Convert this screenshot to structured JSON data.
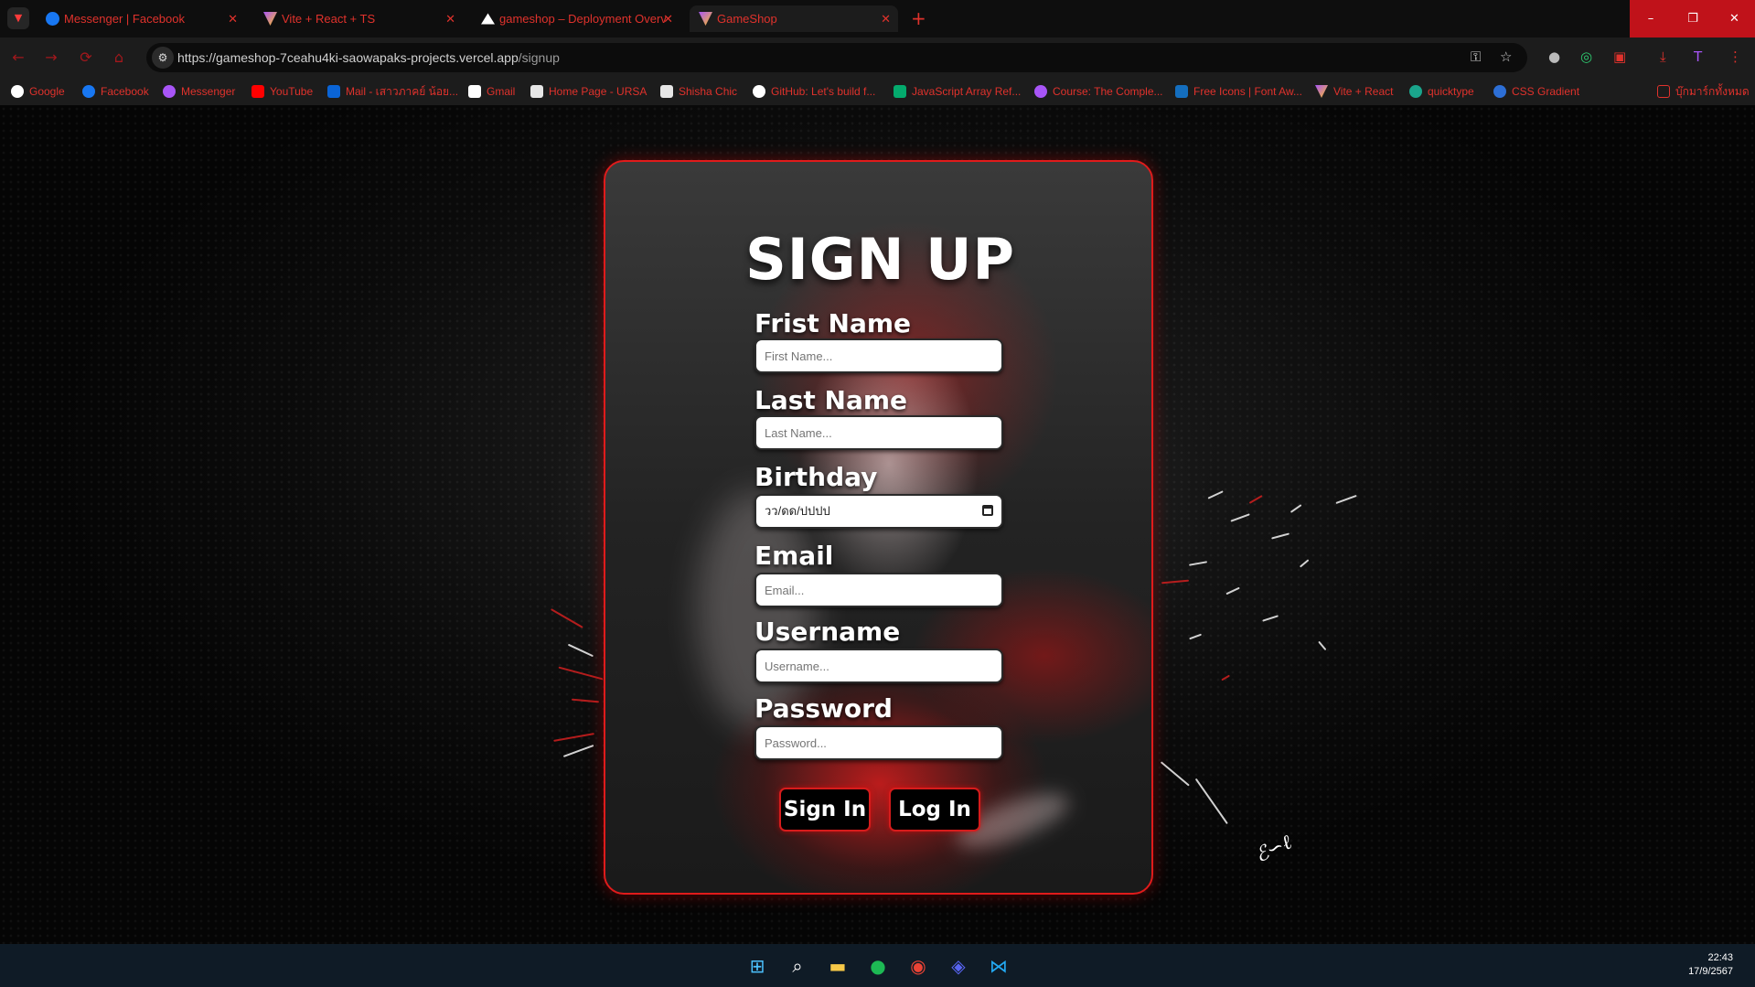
{
  "tabs": [
    {
      "title": "Messenger | Facebook",
      "icon": "facebook-icon",
      "color": "#1877f2"
    },
    {
      "title": "Vite + React + TS",
      "icon": "vite-icon",
      "color": "#a855f7"
    },
    {
      "title": "gameshop – Deployment Overv",
      "icon": "vercel-icon",
      "color": "#ffffff"
    },
    {
      "title": "GameShop",
      "icon": "vite-icon",
      "color": "#a855f7"
    }
  ],
  "window": {
    "minimize": "–",
    "restore": "❐",
    "close": "✕"
  },
  "address": {
    "origin": "https://gameshop-7ceahu4ki-saowapaks-projects.vercel.app",
    "path": "/signup"
  },
  "bookmarks": [
    {
      "label": "Google",
      "icon": "google-icon",
      "color": "#ffffff"
    },
    {
      "label": "Facebook",
      "icon": "facebook-icon",
      "color": "#1877f2"
    },
    {
      "label": "Messenger",
      "icon": "messenger-icon",
      "color": "#a855f7"
    },
    {
      "label": "YouTube",
      "icon": "youtube-icon",
      "color": "#ff0000"
    },
    {
      "label": "Mail - เสาวภาคย์ น้อย...",
      "icon": "outlook-icon",
      "color": "#0a64d6"
    },
    {
      "label": "Gmail",
      "icon": "gmail-icon",
      "color": "#ffffff"
    },
    {
      "label": "Home Page - URSA",
      "icon": "page-icon",
      "color": "#e6e6e6"
    },
    {
      "label": "Shisha Chic",
      "icon": "shisha-icon",
      "color": "#e6e6e6"
    },
    {
      "label": "GitHub: Let's build f...",
      "icon": "github-icon",
      "color": "#ffffff"
    },
    {
      "label": "JavaScript Array Ref...",
      "icon": "w3-icon",
      "color": "#04aa6d"
    },
    {
      "label": "Course: The Comple...",
      "icon": "course-icon",
      "color": "#a855f7"
    },
    {
      "label": "Free Icons | Font Aw...",
      "icon": "flag-icon",
      "color": "#146ebe"
    },
    {
      "label": "Vite + React",
      "icon": "vite-icon",
      "color": "#a855f7"
    },
    {
      "label": "quicktype",
      "icon": "quicktype-icon",
      "color": "#1aa58c"
    },
    {
      "label": "CSS Gradient",
      "icon": "gradient-icon",
      "color": "#2d6fd6"
    },
    {
      "label": "บุ๊กมาร์กทั้งหมด",
      "icon": "folder-icon",
      "color": "#e0322c"
    }
  ],
  "form": {
    "title": "SIGN UP",
    "first_name": {
      "label": "Frist Name",
      "placeholder": "First Name..."
    },
    "last_name": {
      "label": "Last Name",
      "placeholder": "Last Name..."
    },
    "birthday": {
      "label": "Birthday",
      "value": "วว/ดด/ปปปป"
    },
    "email": {
      "label": "Email",
      "placeholder": "Email..."
    },
    "username": {
      "label": "Username",
      "placeholder": "Username..."
    },
    "password": {
      "label": "Password",
      "placeholder": "Password..."
    },
    "signin_button": "Sign In",
    "login_button": "Log In"
  },
  "colors": {
    "accent": "#e01b1b",
    "tab_text": "#e0322c",
    "taskbar": "#0f1b26"
  },
  "taskbar": {
    "time": "22:43",
    "date": "17/9/2567"
  }
}
